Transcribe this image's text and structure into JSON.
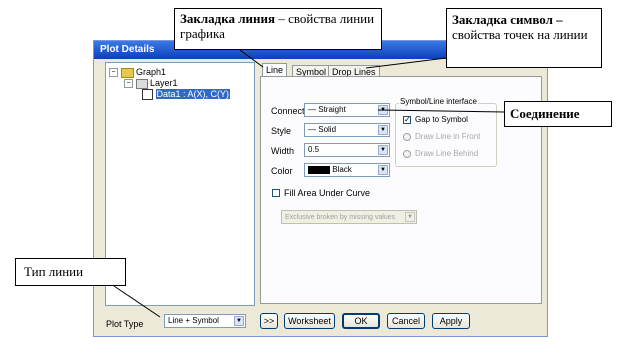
{
  "window": {
    "title": "Plot Details"
  },
  "tree": {
    "graph": "Graph1",
    "layer": "Layer1",
    "data": "Data1 : A(X), C(Y)",
    "expand_minus": "−"
  },
  "tabs": [
    "Line",
    "Symbol",
    "Drop Lines"
  ],
  "form": {
    "connect_label": "Connect",
    "connect_value": "Straight",
    "style_label": "Style",
    "style_value": "Solid",
    "width_label": "Width",
    "width_value": "0.5",
    "color_label": "Color",
    "color_value": "Black",
    "color_swatch": "#000000",
    "fill_label": "Fill Area Under Curve",
    "exclusive_value": "Exclusive broken by missing values",
    "dropdown_glyph": "▼"
  },
  "symbol_group": {
    "title": "Symbol/Line interface",
    "gap_label": "Gap to Symbol",
    "gap_checked": true,
    "front_label": "Draw Line in Front",
    "behind_label": "Draw Line Behind"
  },
  "bottom": {
    "plot_type_label": "Plot Type",
    "plot_type_value": "Line + Symbol",
    "more_label": ">>",
    "worksheet_label": "Worksheet",
    "ok_label": "OK",
    "cancel_label": "Cancel",
    "apply_label": "Apply"
  },
  "callouts": {
    "line_tab_bold": "Закладка линия",
    "line_tab_rest": " – свойства линии графика",
    "symbol_tab_bold": "Закладка символ –",
    "symbol_tab_rest": " свойства точек на линии",
    "connection": "Соединение",
    "line_type": "Тип линии"
  }
}
